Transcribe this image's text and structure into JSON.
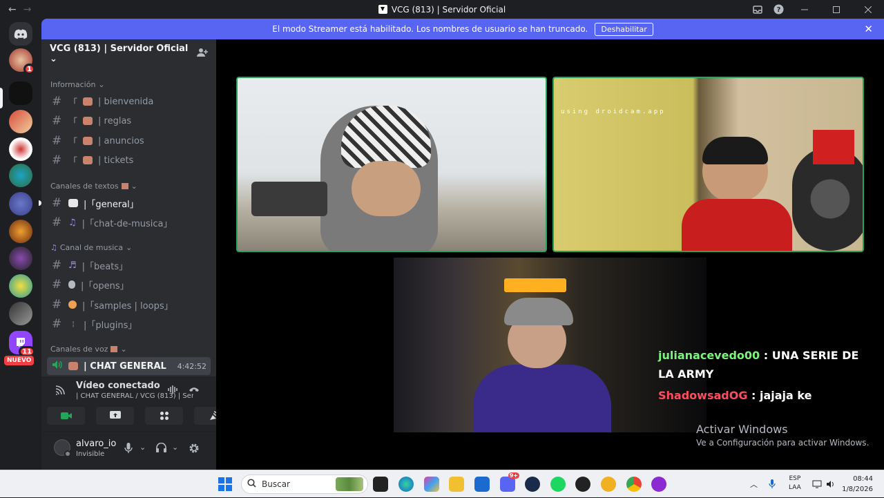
{
  "window": {
    "title": "VCG (813) | Servidor Oficial",
    "back": "←",
    "forward": "→",
    "controls": [
      "inbox-icon",
      "help-icon",
      "minimize-icon",
      "maximize-icon",
      "close-icon"
    ]
  },
  "banner": {
    "text": "El modo Streamer está habilitado. Los nombres de usuario se han truncado.",
    "button": "Deshabilitar",
    "close": "✕"
  },
  "rail": {
    "badges": [
      "1",
      "11"
    ],
    "nuevo": "NUEVO"
  },
  "server": {
    "name": "VCG (813) | Servidor Oficial",
    "categories": [
      {
        "label": "Información"
      },
      {
        "label": "Canales de textos"
      },
      {
        "label": "Canal de musica"
      },
      {
        "label": "Canales de voz"
      }
    ],
    "channels": [
      {
        "label": "| bienvenida"
      },
      {
        "label": "| reglas"
      },
      {
        "label": "| anuncios"
      },
      {
        "label": "| tickets"
      },
      {
        "label": "|「general」"
      },
      {
        "label": "|「chat-de-musica」"
      },
      {
        "label": "|「beats」"
      },
      {
        "label": "|「opens」"
      },
      {
        "label": "|「samples | loops」"
      },
      {
        "label": "|「plugins」"
      }
    ],
    "voice_channel": {
      "label": "| CHAT GENERAL",
      "timer": "4:42:52"
    }
  },
  "voice_connection": {
    "title": "Vídeo conectado",
    "subtitle": "| CHAT GENERAL / VCG (813) | Ser..."
  },
  "user": {
    "name": "alvaro_io",
    "status": "Invisible"
  },
  "overlay": {
    "watermark": "using droidcam.app",
    "chat": [
      {
        "user": "julianacevedo00",
        "message": " : UNA SERIE DE LA ARMY"
      },
      {
        "user": "ShadowsadOG",
        "message": " : jajaja ke"
      }
    ],
    "activate_title": "Activar Windows",
    "activate_sub": "Ve a Configuración para activar Windows."
  },
  "taskbar": {
    "search_placeholder": "Buscar",
    "lang_top": "ESP",
    "lang_bottom": "LAA",
    "time": "08:44",
    "date": "1/8/2026",
    "app_badge": "9+"
  },
  "colors": {
    "accent": "#5865f2",
    "speaking": "#23a55a",
    "chat_user1": "#7cf57c",
    "chat_user2": "#ff4d5e"
  }
}
